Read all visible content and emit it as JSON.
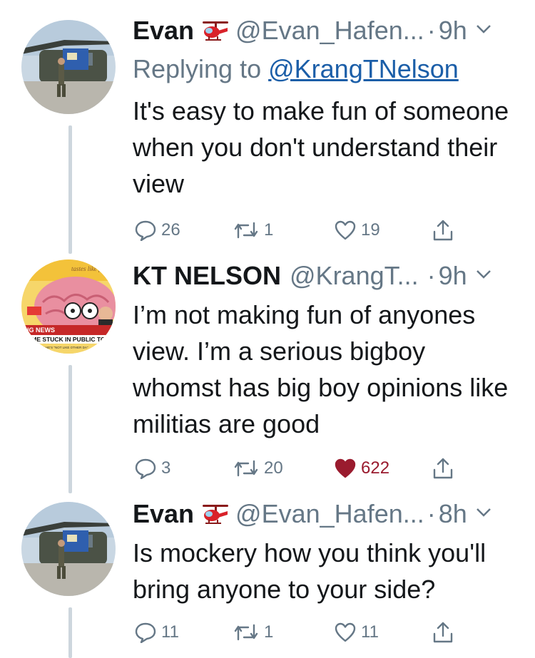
{
  "tweets": [
    {
      "name": "Evan",
      "handle": "@Evan_Hafen...",
      "time": "9h",
      "replying_prefix": "Replying to ",
      "replying_to": "@KrangTNelson",
      "text": "It's easy to make fun of someone when you don't understand their view",
      "replies": "26",
      "retweets": "1",
      "likes": "19",
      "liked": false
    },
    {
      "name": "KT NELSON",
      "handle": "@KrangT...",
      "time": "9h",
      "text": "I’m not making fun of anyones view. I’m a serious bigboy whomst has big boy opinions like militias are good",
      "replies": "3",
      "retweets": "20",
      "likes": "622",
      "liked": true,
      "avatar_text": {
        "top": "tastes like fog",
        "banner": "NG NEWS",
        "headline": "CAME STUCK IN PUBLIC TOI",
        "subline": "MS HE'S \"NOT LIKE OTHER DA\""
      }
    },
    {
      "name": "Evan",
      "handle": "@Evan_Hafen...",
      "time": "8h",
      "text": "Is mockery how you think you'll bring anyone to your side?",
      "replies": "11",
      "retweets": "1",
      "likes": "11",
      "liked": false
    }
  ],
  "colors": {
    "text": "#14171a",
    "muted": "#657786",
    "link": "#1b5ea8",
    "like": "#9a1b2e",
    "thread": "#cdd6dd"
  },
  "icons": [
    "helicopter-emoji",
    "reply-icon",
    "retweet-icon",
    "heart-icon",
    "share-icon",
    "chevron-down-icon"
  ]
}
